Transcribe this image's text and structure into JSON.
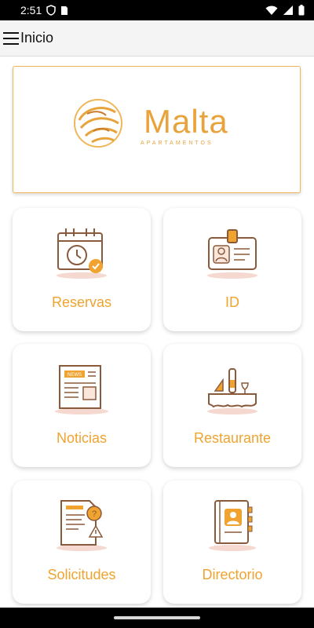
{
  "status_bar": {
    "time": "2:51"
  },
  "app_bar": {
    "title": "Inicio"
  },
  "logo": {
    "name": "Malta",
    "subtitle": "APARTAMENTOS"
  },
  "cards": [
    {
      "label": "Reservas",
      "icon": "calendar-clock-icon"
    },
    {
      "label": "ID",
      "icon": "id-card-icon"
    },
    {
      "label": "Noticias",
      "icon": "newspaper-icon"
    },
    {
      "label": "Restaurante",
      "icon": "restaurant-table-icon"
    },
    {
      "label": "Solicitudes",
      "icon": "request-document-icon"
    },
    {
      "label": "Directorio",
      "icon": "directory-book-icon"
    }
  ],
  "colors": {
    "accent": "#f0a32f",
    "icon_brown": "#8a5a3c",
    "logo_gold": "#e8a33c"
  }
}
